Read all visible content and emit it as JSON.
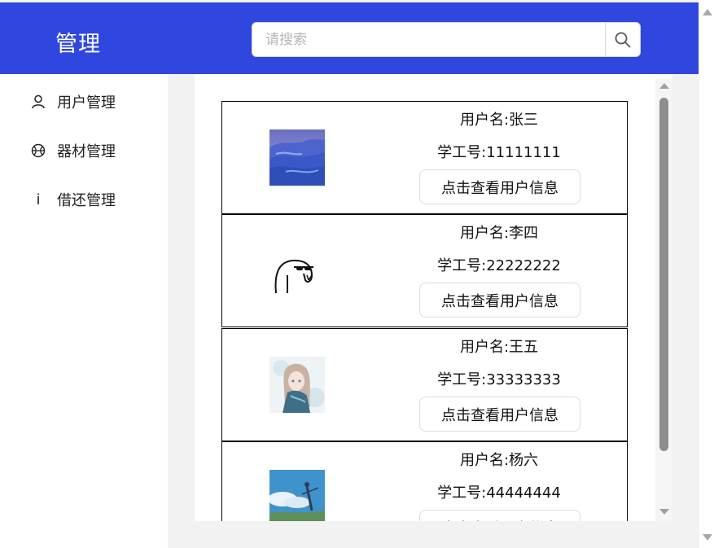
{
  "header": {
    "title": "管理",
    "search": {
      "placeholder": "请搜索",
      "value": "",
      "icon": "search-icon"
    }
  },
  "sidebar": {
    "items": [
      {
        "label": "用户管理",
        "icon": "user-icon"
      },
      {
        "label": "器材管理",
        "icon": "basketball-icon"
      },
      {
        "label": "借还管理",
        "icon": "info-icon",
        "icon_glyph": "i"
      }
    ]
  },
  "users": [
    {
      "username": "用户名:张三",
      "id": "学工号:11111111",
      "button": "点击查看用户信息",
      "avatar": "blue-dunes-landscape"
    },
    {
      "username": "用户名:李四",
      "id": "学工号:22222222",
      "button": "点击查看用户信息",
      "avatar": "sketch-character-sunglasses"
    },
    {
      "username": "用户名:王五",
      "id": "学工号:33333333",
      "button": "点击查看用户信息",
      "avatar": "anime-girl-illustration"
    },
    {
      "username": "用户名:杨六",
      "id": "学工号:44444444",
      "button": "点击查看用户信息",
      "avatar": "anime-sky-scene"
    }
  ],
  "colors": {
    "header_bg": "#2f47de",
    "card_border": "#000000",
    "scroll_thumb": "#8e8e8e"
  }
}
